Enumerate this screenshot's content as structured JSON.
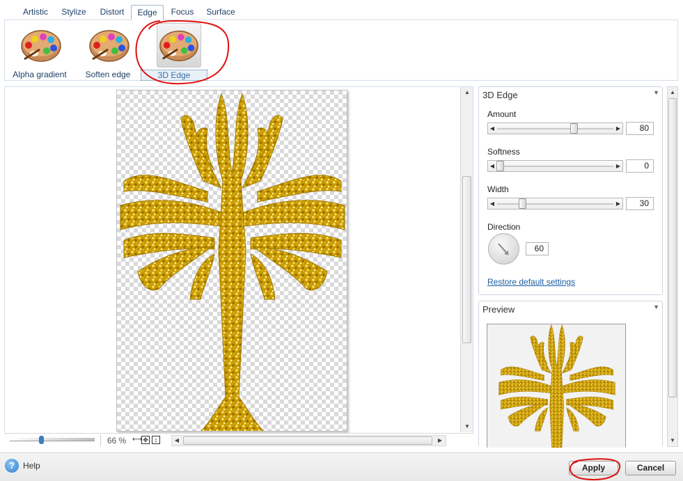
{
  "tabs": [
    "Artistic",
    "Stylize",
    "Distort",
    "Edge",
    "Focus",
    "Surface"
  ],
  "active_tab": "Edge",
  "effects": [
    {
      "label": "Alpha gradient",
      "icon": "palette-icon"
    },
    {
      "label": "Soften edge",
      "icon": "palette-icon"
    },
    {
      "label": "3D Edge",
      "icon": "palette-icon",
      "selected": true
    }
  ],
  "statusbar": {
    "zoom": "66 %"
  },
  "panel": {
    "title": "3D Edge",
    "amount": {
      "label": "Amount",
      "value": "80"
    },
    "softness": {
      "label": "Softness",
      "value": "0"
    },
    "width": {
      "label": "Width",
      "value": "30"
    },
    "direction": {
      "label": "Direction",
      "value": "60"
    },
    "restore_label": "Restore default settings"
  },
  "preview": {
    "title": "Preview"
  },
  "footer": {
    "help_label": "Help",
    "apply_label": "Apply",
    "cancel_label": "Cancel"
  },
  "colors": {
    "accent": "#1c5fa0",
    "gold": "#d4a500",
    "annotation": "#e01010"
  }
}
